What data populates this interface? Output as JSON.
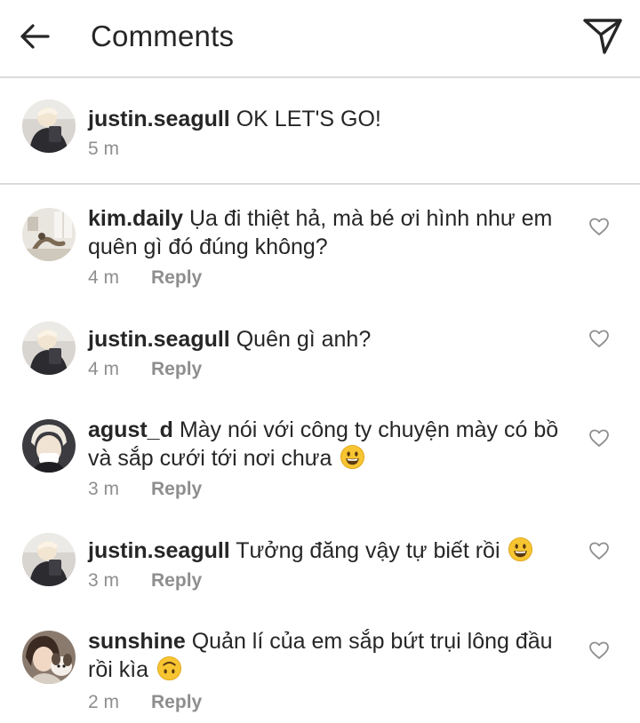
{
  "header": {
    "title": "Comments"
  },
  "caption": {
    "username": "justin.seagull",
    "text": "OK LET'S GO!",
    "time": "5 m"
  },
  "comments": [
    {
      "username": "kim.daily",
      "text": "Ụa đi thiệt hả, mà bé ơi hình như em quên gì đó đúng không?",
      "emoji": "",
      "time": "4 m",
      "reply": "Reply"
    },
    {
      "username": "justin.seagull",
      "text": "Quên gì anh?",
      "emoji": "",
      "time": "4 m",
      "reply": "Reply"
    },
    {
      "username": "agust_d",
      "text": "Mày nói với công ty chuyện mày có bồ và sắp cưới tới nơi chưa",
      "emoji": "grinning-face",
      "time": "3 m",
      "reply": "Reply"
    },
    {
      "username": "justin.seagull",
      "text": "Tưởng đăng vậy tự biết rồi",
      "emoji": "grinning-face",
      "time": "3 m",
      "reply": "Reply"
    },
    {
      "username": "sunshine",
      "text": "Quản lí của em sắp bứt trụi lông đầu rồi kìa",
      "emoji": "upside-down-face",
      "time": "2 m",
      "reply": "Reply"
    }
  ],
  "icons": {
    "back": "back-arrow-icon",
    "send": "paper-plane-icon",
    "like": "heart-outline-icon"
  },
  "colors": {
    "text": "#262626",
    "secondary": "#8e8e8e",
    "divider": "#dbdbdb",
    "emoji": "#f7c531"
  }
}
